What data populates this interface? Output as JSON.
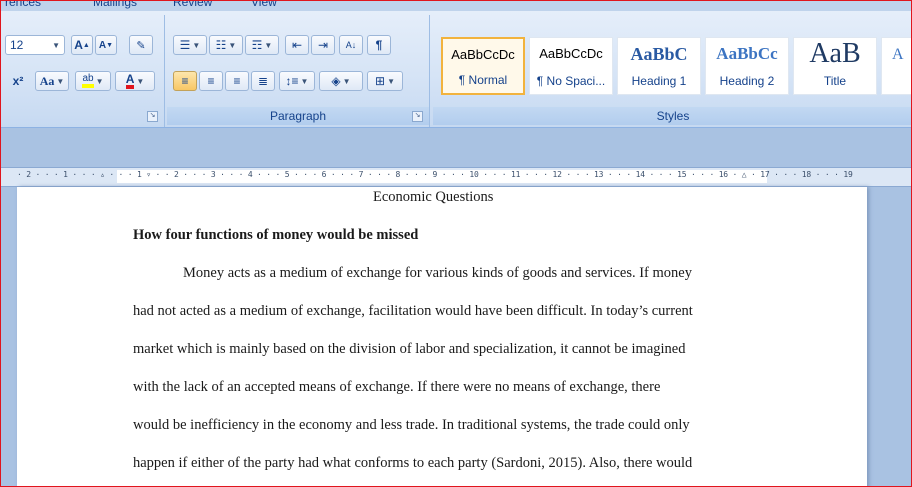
{
  "ribbon_tabs": [
    "rences",
    "Mailings",
    "Review",
    "View"
  ],
  "font": {
    "size_value": "12",
    "grow_glyph": "A",
    "shrink_glyph": "A",
    "superscript_glyph": "x²",
    "change_case_glyph": "Aa",
    "highlight_glyph": "ab",
    "font_color_glyph": "A",
    "highlight_color": "#ffff00",
    "font_color": "#e0151d"
  },
  "paragraph": {
    "label": "Paragraph",
    "sort_glyph": "A↓",
    "pilcrow_glyph": "¶"
  },
  "styles": {
    "label": "Styles",
    "items": [
      {
        "sample": "AaBbCcDc",
        "name": "¶ Normal",
        "selected": true
      },
      {
        "sample": "AaBbCcDc",
        "name": "¶ No Spaci...",
        "selected": false
      },
      {
        "sample": "AaBbC",
        "name": "Heading 1",
        "selected": false
      },
      {
        "sample": "AaBbCc",
        "name": "Heading 2",
        "selected": false
      },
      {
        "sample": "AaB",
        "name": "Title",
        "selected": false
      },
      {
        "sample": "A",
        "name": "",
        "selected": false
      }
    ]
  },
  "ruler_text": "· 2 · · · 1 · · · ▵ · · · 1 ▿ · · 2 · · · 3 · · · 4 · · · 5 · · · 6 · · · 7 · · · 8 · · · 9 · · · 10 · · · 11 · · · 12 · · · 13 · · · 14 · · · 15 · · · 16 · △ · 17 · · · 18 · · · 19",
  "document": {
    "title": "Economic Questions",
    "heading": "How four functions of money would be missed",
    "lines": [
      "Money acts as a medium of exchange for various kinds of goods and services.  If money",
      "had not acted as a medium of exchange, facilitation would have been difficult.  In today’s current",
      "market which is  mainly based on the division  of labor and specialization, it  cannot be imagined",
      "with the lack of an accepted means of exchange. If there were no means of exchange, there",
      "would be inefficiency in the economy and less trade. In traditional systems, the trade could only",
      "happen if either of the party had what conforms to each party (Sardoni, 2015). Also,  there would"
    ]
  }
}
